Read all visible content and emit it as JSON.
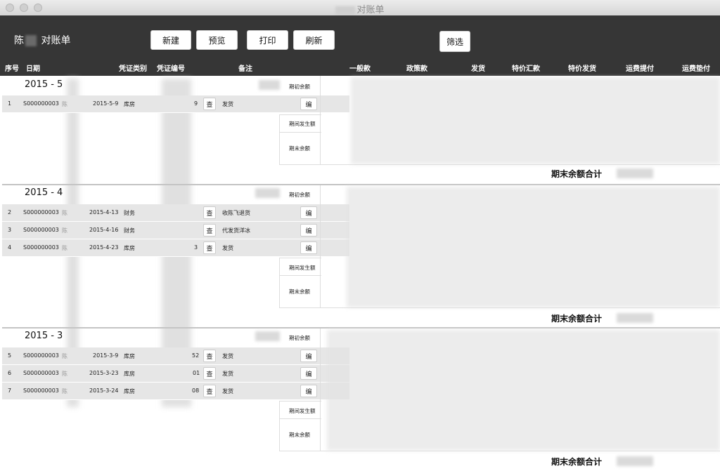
{
  "window": {
    "title": "对账单"
  },
  "toolbar": {
    "name_prefix": "陈",
    "name_suffix": "对账单",
    "new_label": "新建",
    "preview_label": "预览",
    "print_label": "打印",
    "refresh_label": "刷新",
    "filter_label": "筛选"
  },
  "columns": {
    "seq": "序号",
    "date": "日期",
    "voucher_type": "凭证类别",
    "voucher_no": "凭证编号",
    "note": "备注",
    "general": "一般款",
    "policy": "政策款",
    "shipment": "发货",
    "special_remit": "特价汇款",
    "special_ship": "特价发货",
    "freight_pick": "运费提付",
    "freight_advance": "运费垫付"
  },
  "labels": {
    "opening": "期初余额",
    "period_change": "期间发生额",
    "closing": "期末余额",
    "closing_total": "期末余额合计",
    "view_btn": "查",
    "edit_btn": "编"
  },
  "sections": [
    {
      "period": "2015 - 5",
      "rows": [
        {
          "seq": "1",
          "code": "S000000003",
          "name": "陈",
          "date": "2015-5-9",
          "type": "库房",
          "voucher_tail": "9",
          "note": "发货"
        }
      ]
    },
    {
      "period": "2015 - 4",
      "rows": [
        {
          "seq": "2",
          "code": "S000000003",
          "name": "陈",
          "date": "2015-4-13",
          "type": "财务",
          "voucher_tail": "",
          "note": "收陈飞退货"
        },
        {
          "seq": "3",
          "code": "S000000003",
          "name": "陈",
          "date": "2015-4-16",
          "type": "财务",
          "voucher_tail": "",
          "note": "代发货洋冰"
        },
        {
          "seq": "4",
          "code": "S000000003",
          "name": "陈",
          "date": "2015-4-23",
          "type": "库房",
          "voucher_tail": "3",
          "note": "发货"
        }
      ]
    },
    {
      "period": "2015 - 3",
      "rows": [
        {
          "seq": "5",
          "code": "S000000003",
          "name": "陈",
          "date": "2015-3-9",
          "type": "库房",
          "voucher_tail": "52",
          "note": "发货"
        },
        {
          "seq": "6",
          "code": "S000000003",
          "name": "陈",
          "date": "2015-3-23",
          "type": "库房",
          "voucher_tail": "01",
          "note": "发货"
        },
        {
          "seq": "7",
          "code": "S000000003",
          "name": "陈",
          "date": "2015-3-24",
          "type": "库房",
          "voucher_tail": "08",
          "note": "发货"
        }
      ]
    }
  ]
}
